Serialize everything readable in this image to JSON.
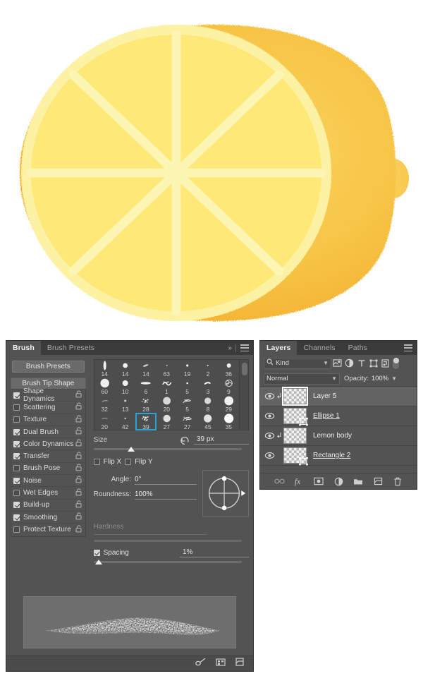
{
  "artwork": {
    "name": "lemon-half-illustration",
    "colors": {
      "rind_outer": "#f5c242",
      "rind_outer_dark": "#f0ab2e",
      "rind_highlight": "#fbd55e",
      "pith_ring": "#fdf0a0",
      "flesh": "#fde878",
      "segment_divider": "#fdf5b2",
      "nub": "#fbcf55",
      "background": "#ffffff"
    },
    "segments": 8
  },
  "brush_panel": {
    "tabs": [
      {
        "label": "Brush",
        "active": true
      },
      {
        "label": "Brush Presets",
        "active": false
      }
    ],
    "overflow_label": "»",
    "buttons": {
      "brush_presets": "Brush Presets",
      "brush_tip_shape": "Brush Tip Shape"
    },
    "options": [
      {
        "label": "Shape Dynamics",
        "checked": true,
        "locked": false
      },
      {
        "label": "Scattering",
        "checked": false,
        "locked": false
      },
      {
        "label": "Texture",
        "checked": false,
        "locked": false
      },
      {
        "label": "Dual Brush",
        "checked": true,
        "locked": false
      },
      {
        "label": "Color Dynamics",
        "checked": true,
        "locked": false
      },
      {
        "label": "Transfer",
        "checked": true,
        "locked": false
      },
      {
        "label": "Brush Pose",
        "checked": false,
        "locked": false
      },
      {
        "label": "Noise",
        "checked": true,
        "locked": false
      },
      {
        "label": "Wet Edges",
        "checked": false,
        "locked": false
      },
      {
        "label": "Build-up",
        "checked": true,
        "locked": false
      },
      {
        "label": "Smoothing",
        "checked": true,
        "locked": false
      },
      {
        "label": "Protect Texture",
        "checked": false,
        "locked": false
      }
    ],
    "brush_grid": {
      "selected_index": 23,
      "selection_color": "#2aa3d6",
      "cells": [
        {
          "size": "14",
          "tip": "vertical-stroke"
        },
        {
          "size": "14",
          "tip": "round-soft-small"
        },
        {
          "size": "14",
          "tip": "flat-flick"
        },
        {
          "size": "63",
          "tip": "tiny-dot"
        },
        {
          "size": "19",
          "tip": "small-dot"
        },
        {
          "size": "2",
          "tip": "pin-dot"
        },
        {
          "size": "36",
          "tip": "round-hard-small"
        },
        {
          "size": "60",
          "tip": "round-soft-large"
        },
        {
          "size": "10",
          "tip": "round-soft-medium"
        },
        {
          "size": "6",
          "tip": "flat-oval"
        },
        {
          "size": "1",
          "tip": "scribble-texture"
        },
        {
          "size": "5",
          "tip": "micro-dot"
        },
        {
          "size": "3",
          "tip": "comma-flick"
        },
        {
          "size": "9",
          "tip": "scatter-swirl"
        },
        {
          "size": "32",
          "tip": "faint-flick"
        },
        {
          "size": "13",
          "tip": "tiny-spark"
        },
        {
          "size": "28",
          "tip": "chalk-scatter"
        },
        {
          "size": "20",
          "tip": "round-soft-glow"
        },
        {
          "size": "5",
          "tip": "spatter-streak"
        },
        {
          "size": "8",
          "tip": "round-soft-glow2"
        },
        {
          "size": "29",
          "tip": "round-solid-large"
        },
        {
          "size": "20",
          "tip": "faint-dash"
        },
        {
          "size": "42",
          "tip": "tiny-speck"
        },
        {
          "size": "39",
          "tip": "chalk-scatter-selected"
        },
        {
          "size": "27",
          "tip": "round-soft-glow3"
        },
        {
          "size": "27",
          "tip": "spatter-streak2"
        },
        {
          "size": "45",
          "tip": "round-soft-glow4"
        },
        {
          "size": "35",
          "tip": "round-solid-white"
        }
      ]
    },
    "size": {
      "label": "Size",
      "value": "39 px",
      "reset_icon": "reset-arrow-icon",
      "slider_percent": 23
    },
    "flip_x": {
      "label": "Flip X",
      "checked": false
    },
    "flip_y": {
      "label": "Flip Y",
      "checked": false
    },
    "angle": {
      "label": "Angle:",
      "value": "0°"
    },
    "roundness": {
      "label": "Roundness:",
      "value": "100%"
    },
    "hardness": {
      "label": "Hardness",
      "value": "",
      "disabled": true
    },
    "spacing": {
      "label": "Spacing",
      "checked": true,
      "value": "1%",
      "slider_percent": 1
    },
    "footer_icons": [
      "brush-tool-icon",
      "toggle-pressure-icon",
      "new-brush-icon"
    ],
    "preview_stroke": "chalky-scatter-stroke"
  },
  "layers_panel": {
    "tabs": [
      {
        "label": "Layers",
        "active": true
      },
      {
        "label": "Channels",
        "active": false
      },
      {
        "label": "Paths",
        "active": false
      }
    ],
    "filter": {
      "kind_label": "Kind",
      "search_icon": "search-icon",
      "icons": [
        "pixel-layer-filter-icon",
        "adjustment-layer-filter-icon",
        "type-layer-filter-icon",
        "shape-layer-filter-icon",
        "smart-object-filter-icon"
      ],
      "toggle": "filter-enable-toggle"
    },
    "blend_mode": "Normal",
    "opacity_label": "Opacity:",
    "opacity_value": "100%",
    "layers": [
      {
        "name": "Layer 5",
        "visible": true,
        "selected": true,
        "clipped": true,
        "underlined": false,
        "vector": false
      },
      {
        "name": "Ellipse 1",
        "visible": true,
        "selected": false,
        "clipped": false,
        "underlined": true,
        "vector": true
      },
      {
        "name": "Lemon body",
        "visible": true,
        "selected": false,
        "clipped": true,
        "underlined": false,
        "vector": false
      },
      {
        "name": "Rectangle 2",
        "visible": true,
        "selected": false,
        "clipped": false,
        "underlined": true,
        "vector": true
      }
    ],
    "footer_icons": [
      "link-layers-icon",
      "layer-style-fx-icon",
      "layer-mask-icon",
      "adjustment-layer-icon",
      "new-group-icon",
      "new-layer-icon",
      "delete-layer-icon"
    ]
  }
}
